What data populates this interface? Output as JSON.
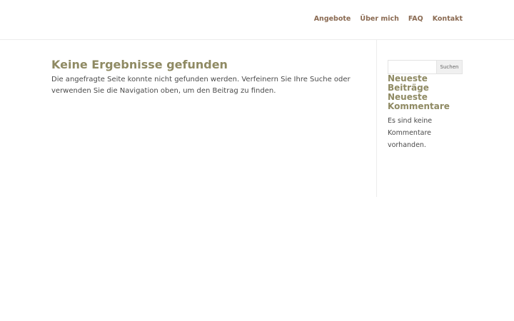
{
  "nav": {
    "items": [
      "Angebote",
      "Über mich",
      "FAQ",
      "Kontakt"
    ]
  },
  "main": {
    "title": "Keine Ergebnisse gefunden",
    "body": "Die angefragte Seite konnte nicht gefunden werden. Verfeinern Sie Ihre Suche oder verwenden Sie die Navigation oben, um den Beitrag zu finden."
  },
  "sidebar": {
    "search": {
      "value": "",
      "placeholder": "",
      "button_label": "Suchen"
    },
    "recent_posts_title": "Neueste Beiträge",
    "recent_comments_title": "Neueste Kommentare",
    "recent_comments_empty": "Es sind keine Kommentare vorhanden."
  },
  "colors": {
    "nav_link": "#8a6a52",
    "heading": "#8f8a63",
    "text": "#4a4a4a",
    "divider": "#ececec"
  }
}
